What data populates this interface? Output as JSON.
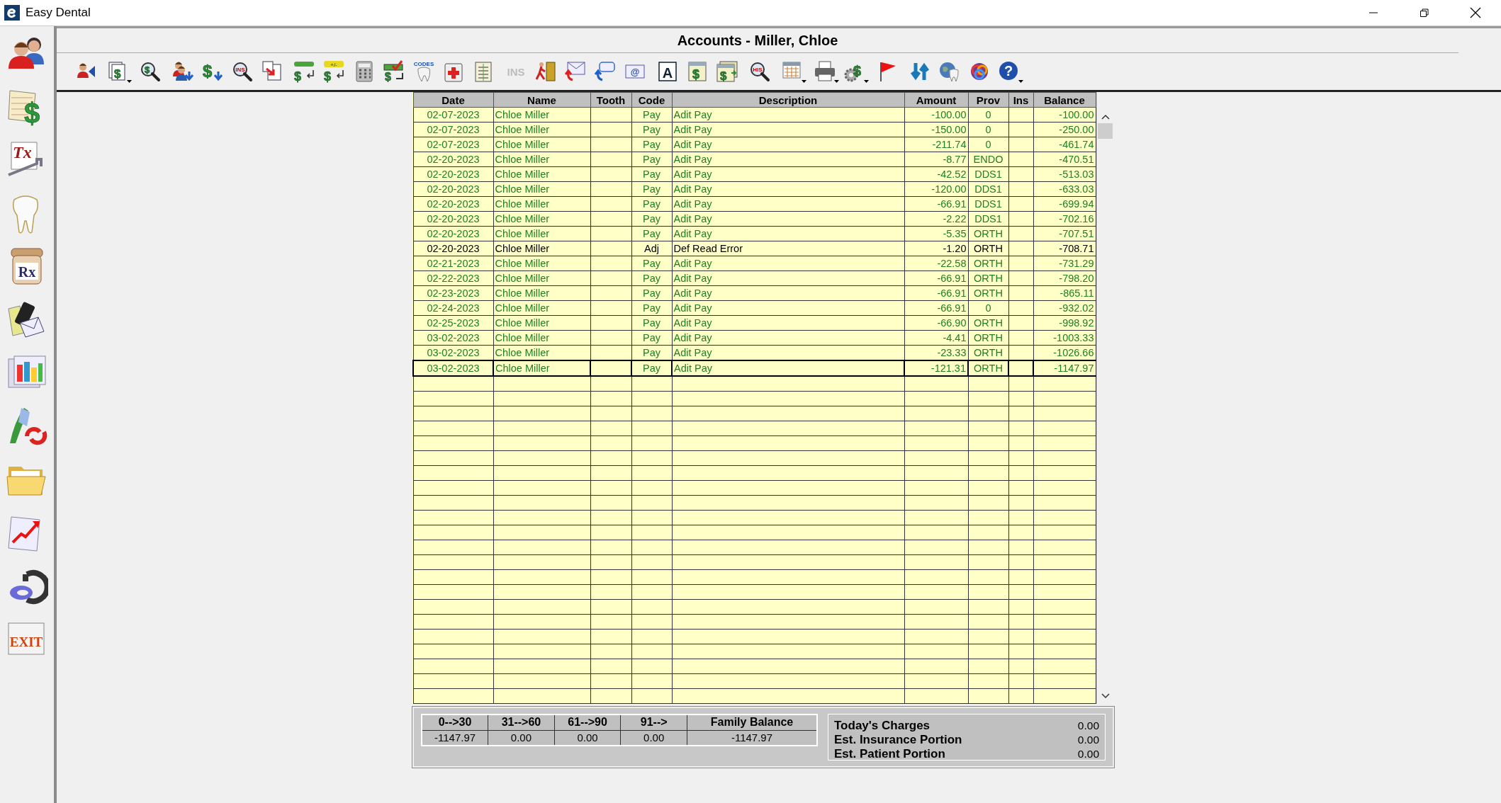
{
  "window": {
    "title": "Easy Dental"
  },
  "sidebar": {
    "items": [
      {
        "kind": "patients"
      },
      {
        "kind": "ledger",
        "sign": "$"
      },
      {
        "kind": "treatment",
        "label": "Tx"
      },
      {
        "kind": "tooth"
      },
      {
        "kind": "prescription",
        "label": "Rx"
      },
      {
        "kind": "messages"
      },
      {
        "kind": "charts"
      },
      {
        "kind": "recall"
      },
      {
        "kind": "folder"
      },
      {
        "kind": "trend"
      },
      {
        "kind": "edental"
      },
      {
        "kind": "exit",
        "label": "EXIT"
      }
    ]
  },
  "panel": {
    "title": "Accounts - Miller, Chloe"
  },
  "toolbar": {
    "groups": [
      [
        {
          "kind": "patientback"
        }
      ],
      [
        {
          "kind": "statements",
          "menu": true,
          "sign": "$"
        }
      ],
      [
        {
          "kind": "dollarsearch",
          "sign": "$"
        }
      ],
      [
        {
          "kind": "patientsdown"
        },
        {
          "kind": "dollardown",
          "sign": "$"
        },
        {
          "kind": "inssearch",
          "label": "INS"
        },
        {
          "kind": "pagearrow"
        }
      ],
      [
        {
          "kind": "dollarenter",
          "sign": "$"
        },
        {
          "kind": "dollaradjust",
          "label": "+/-",
          "sign": "$"
        },
        {
          "kind": "calculator"
        },
        {
          "kind": "dollarcheck",
          "sign": "$"
        },
        {
          "kind": "codes",
          "label": "CODES"
        },
        {
          "kind": "medkit"
        },
        {
          "kind": "clipboard"
        }
      ],
      [
        {
          "kind": "instext",
          "label": "INS",
          "disabled": true
        },
        {
          "kind": "walkout"
        },
        {
          "kind": "mailarrow"
        },
        {
          "kind": "speecharrow"
        },
        {
          "kind": "email",
          "label": "@"
        }
      ],
      [
        {
          "kind": "letter",
          "label": "A"
        },
        {
          "kind": "dollarpage",
          "sign": "$"
        },
        {
          "kind": "dollarpages",
          "sign": "$"
        }
      ],
      [
        {
          "kind": "hissearch",
          "label": "HIS"
        }
      ],
      [
        {
          "kind": "calendar",
          "menu": true
        }
      ],
      [
        {
          "kind": "printer",
          "menu": true
        },
        {
          "kind": "geardollar",
          "menu": true,
          "sign": "$"
        }
      ],
      [
        {
          "kind": "flag"
        }
      ],
      [
        {
          "kind": "refresh"
        },
        {
          "kind": "globetooth"
        },
        {
          "kind": "rings"
        },
        {
          "kind": "help",
          "label": "?",
          "menu": true
        }
      ]
    ]
  },
  "table": {
    "columns": [
      "Date",
      "Name",
      "Tooth",
      "Code",
      "Description",
      "Amount",
      "Prov",
      "Ins",
      "Balance"
    ],
    "rows": [
      {
        "kind": "payment",
        "selected": false,
        "cells": [
          "02-07-2023",
          "Chloe Miller",
          "",
          "Pay",
          "Adit Pay",
          "-100.00",
          "0",
          "",
          "-100.00"
        ]
      },
      {
        "kind": "payment",
        "selected": false,
        "cells": [
          "02-07-2023",
          "Chloe Miller",
          "",
          "Pay",
          "Adit Pay",
          "-150.00",
          "0",
          "",
          "-250.00"
        ]
      },
      {
        "kind": "payment",
        "selected": false,
        "cells": [
          "02-07-2023",
          "Chloe Miller",
          "",
          "Pay",
          "Adit Pay",
          "-211.74",
          "0",
          "",
          "-461.74"
        ]
      },
      {
        "kind": "payment",
        "selected": false,
        "cells": [
          "02-20-2023",
          "Chloe Miller",
          "",
          "Pay",
          "Adit Pay",
          "-8.77",
          "ENDO",
          "",
          "-470.51"
        ]
      },
      {
        "kind": "payment",
        "selected": false,
        "cells": [
          "02-20-2023",
          "Chloe Miller",
          "",
          "Pay",
          "Adit Pay",
          "-42.52",
          "DDS1",
          "",
          "-513.03"
        ]
      },
      {
        "kind": "payment",
        "selected": false,
        "cells": [
          "02-20-2023",
          "Chloe Miller",
          "",
          "Pay",
          "Adit Pay",
          "-120.00",
          "DDS1",
          "",
          "-633.03"
        ]
      },
      {
        "kind": "payment",
        "selected": false,
        "cells": [
          "02-20-2023",
          "Chloe Miller",
          "",
          "Pay",
          "Adit Pay",
          "-66.91",
          "DDS1",
          "",
          "-699.94"
        ]
      },
      {
        "kind": "payment",
        "selected": false,
        "cells": [
          "02-20-2023",
          "Chloe Miller",
          "",
          "Pay",
          "Adit Pay",
          "-2.22",
          "DDS1",
          "",
          "-702.16"
        ]
      },
      {
        "kind": "payment",
        "selected": false,
        "cells": [
          "02-20-2023",
          "Chloe Miller",
          "",
          "Pay",
          "Adit Pay",
          "-5.35",
          "ORTH",
          "",
          "-707.51"
        ]
      },
      {
        "kind": "adjustment",
        "selected": false,
        "cells": [
          "02-20-2023",
          "Chloe Miller",
          "",
          "Adj",
          "Def Read Error",
          "-1.20",
          "ORTH",
          "",
          "-708.71"
        ]
      },
      {
        "kind": "payment",
        "selected": false,
        "cells": [
          "02-21-2023",
          "Chloe Miller",
          "",
          "Pay",
          "Adit Pay",
          "-22.58",
          "ORTH",
          "",
          "-731.29"
        ]
      },
      {
        "kind": "payment",
        "selected": false,
        "cells": [
          "02-22-2023",
          "Chloe Miller",
          "",
          "Pay",
          "Adit Pay",
          "-66.91",
          "ORTH",
          "",
          "-798.20"
        ]
      },
      {
        "kind": "payment",
        "selected": false,
        "cells": [
          "02-23-2023",
          "Chloe Miller",
          "",
          "Pay",
          "Adit Pay",
          "-66.91",
          "ORTH",
          "",
          "-865.11"
        ]
      },
      {
        "kind": "payment",
        "selected": false,
        "cells": [
          "02-24-2023",
          "Chloe Miller",
          "",
          "Pay",
          "Adit Pay",
          "-66.91",
          "0",
          "",
          "-932.02"
        ]
      },
      {
        "kind": "payment",
        "selected": false,
        "cells": [
          "02-25-2023",
          "Chloe Miller",
          "",
          "Pay",
          "Adit Pay",
          "-66.90",
          "ORTH",
          "",
          "-998.92"
        ]
      },
      {
        "kind": "payment",
        "selected": false,
        "cells": [
          "03-02-2023",
          "Chloe Miller",
          "",
          "Pay",
          "Adit Pay",
          "-4.41",
          "ORTH",
          "",
          "-1003.33"
        ]
      },
      {
        "kind": "payment",
        "selected": false,
        "cells": [
          "03-02-2023",
          "Chloe Miller",
          "",
          "Pay",
          "Adit Pay",
          "-23.33",
          "ORTH",
          "",
          "-1026.66"
        ]
      },
      {
        "kind": "payment",
        "selected": true,
        "cells": [
          "03-02-2023",
          "Chloe Miller",
          "",
          "Pay",
          "Adit Pay",
          "-121.31",
          "ORTH",
          "",
          "-1147.97"
        ]
      }
    ]
  },
  "aging": {
    "columns": [
      {
        "label": "0-->30",
        "value": "-1147.97"
      },
      {
        "label": "31-->60",
        "value": "0.00"
      },
      {
        "label": "61-->90",
        "value": "0.00"
      },
      {
        "label": "91-->",
        "value": "0.00"
      },
      {
        "label": "Family Balance",
        "value": "-1147.97"
      }
    ]
  },
  "summary": [
    {
      "label": "Today's Charges",
      "value": "0.00"
    },
    {
      "label": "Est. Insurance Portion",
      "value": "0.00"
    },
    {
      "label": "Est. Patient Portion",
      "value": "0.00"
    }
  ]
}
